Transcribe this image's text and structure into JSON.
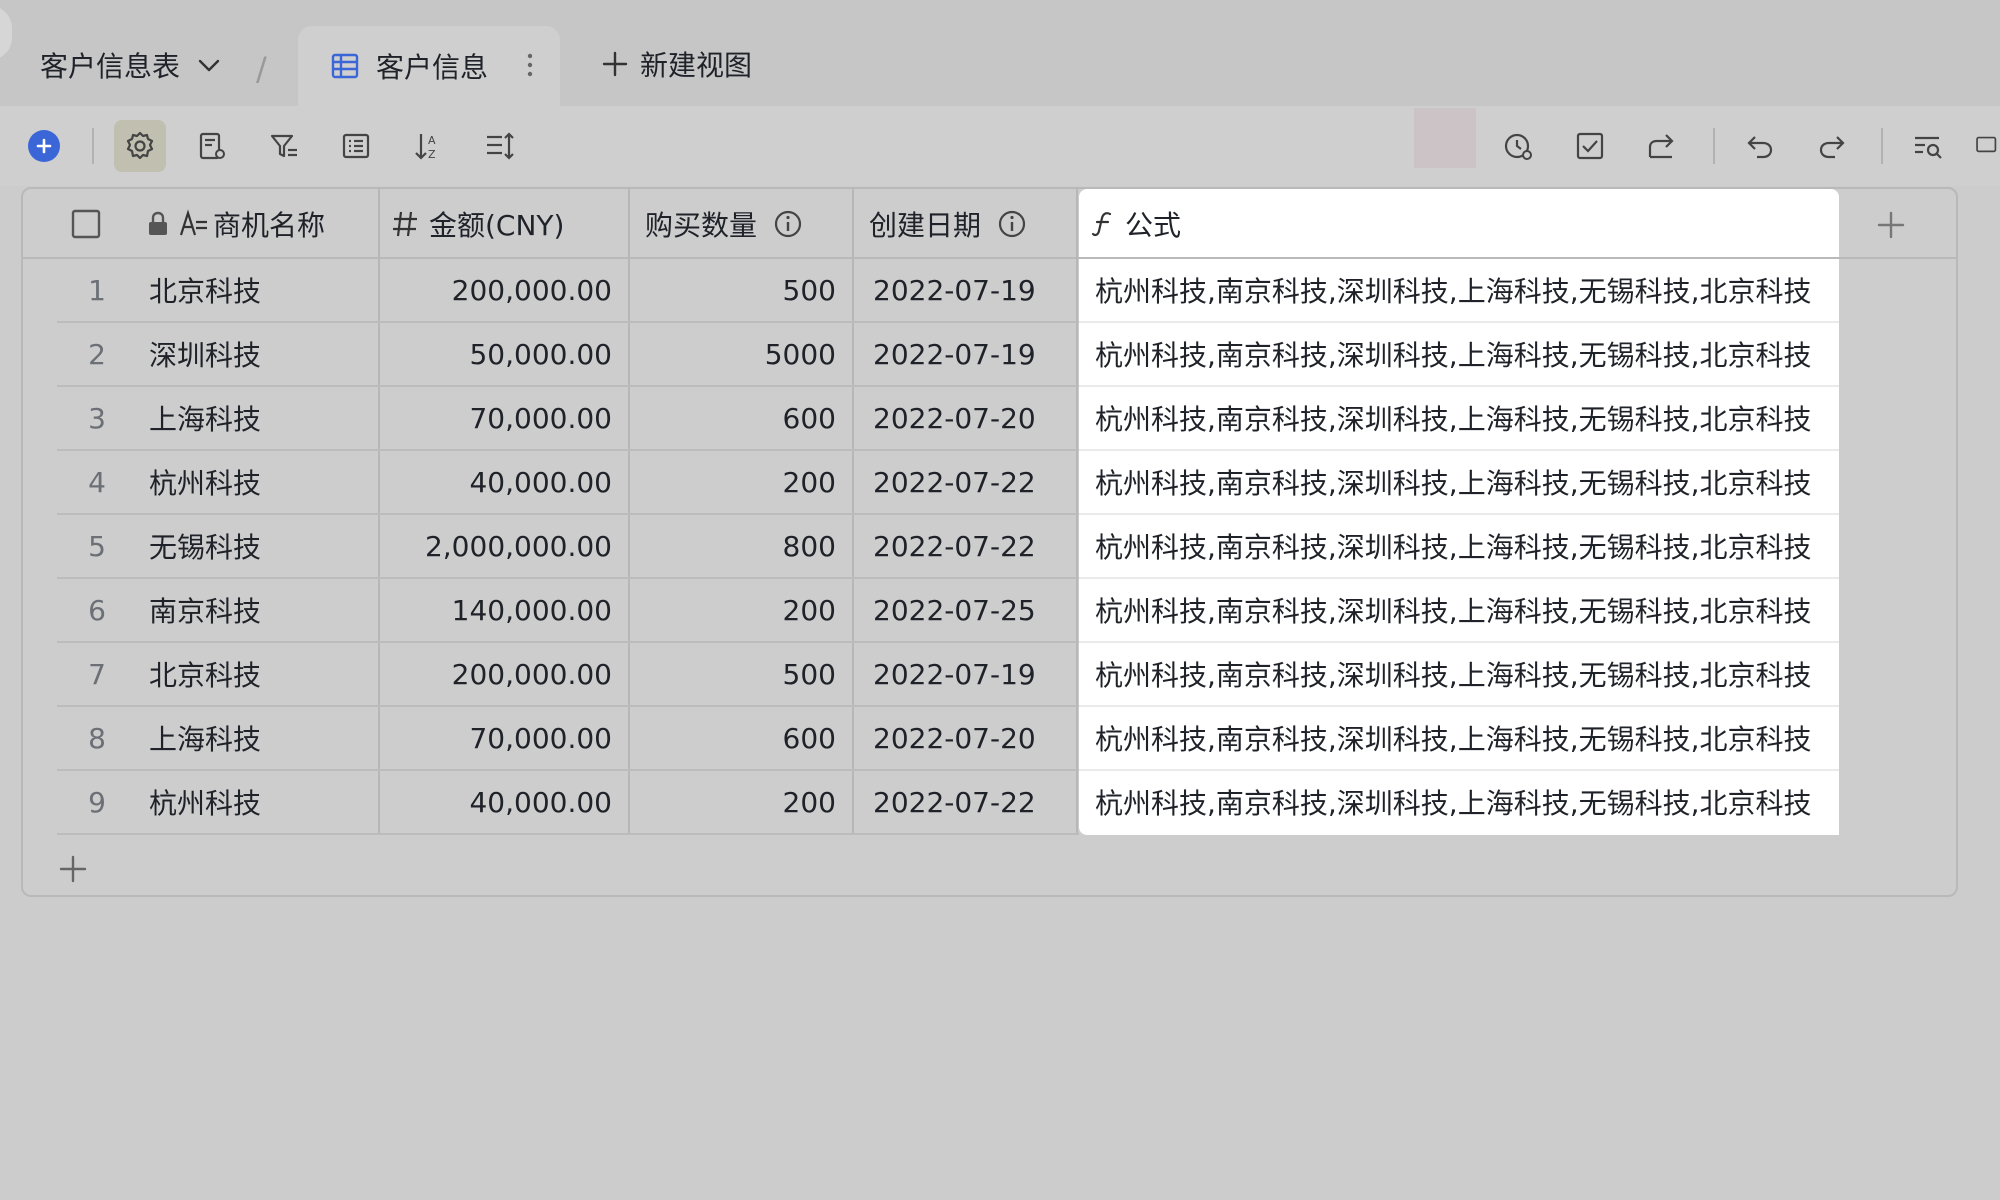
{
  "header": {
    "table_name": "客户信息表",
    "active_tab": "客户信息",
    "new_view_label": "新建视图"
  },
  "toolbar": {
    "left_icons": [
      "add-icon",
      "settings-icon",
      "form-icon",
      "filter-icon",
      "list-icon",
      "sort-icon",
      "row-height-icon"
    ],
    "right_icons": [
      "history-icon",
      "checkbox-icon",
      "share-icon",
      "undo-icon",
      "redo-icon",
      "search-icon",
      "comment-icon"
    ],
    "accent_color": "#3a66d8"
  },
  "columns": {
    "name": "商机名称",
    "amount": "金额(CNY)",
    "quantity": "购买数量",
    "date": "创建日期",
    "formula": "公式"
  },
  "rows": [
    {
      "index": "1",
      "name": "北京科技",
      "amount": "200,000.00",
      "quantity": "500",
      "date": "2022-07-19",
      "formula": "杭州科技,南京科技,深圳科技,上海科技,无锡科技,北京科技"
    },
    {
      "index": "2",
      "name": "深圳科技",
      "amount": "50,000.00",
      "quantity": "5000",
      "date": "2022-07-19",
      "formula": "杭州科技,南京科技,深圳科技,上海科技,无锡科技,北京科技"
    },
    {
      "index": "3",
      "name": "上海科技",
      "amount": "70,000.00",
      "quantity": "600",
      "date": "2022-07-20",
      "formula": "杭州科技,南京科技,深圳科技,上海科技,无锡科技,北京科技"
    },
    {
      "index": "4",
      "name": "杭州科技",
      "amount": "40,000.00",
      "quantity": "200",
      "date": "2022-07-22",
      "formula": "杭州科技,南京科技,深圳科技,上海科技,无锡科技,北京科技"
    },
    {
      "index": "5",
      "name": "无锡科技",
      "amount": "2,000,000.00",
      "quantity": "800",
      "date": "2022-07-22",
      "formula": "杭州科技,南京科技,深圳科技,上海科技,无锡科技,北京科技"
    },
    {
      "index": "6",
      "name": "南京科技",
      "amount": "140,000.00",
      "quantity": "200",
      "date": "2022-07-25",
      "formula": "杭州科技,南京科技,深圳科技,上海科技,无锡科技,北京科技"
    },
    {
      "index": "7",
      "name": "北京科技",
      "amount": "200,000.00",
      "quantity": "500",
      "date": "2022-07-19",
      "formula": "杭州科技,南京科技,深圳科技,上海科技,无锡科技,北京科技"
    },
    {
      "index": "8",
      "name": "上海科技",
      "amount": "70,000.00",
      "quantity": "600",
      "date": "2022-07-20",
      "formula": "杭州科技,南京科技,深圳科技,上海科技,无锡科技,北京科技"
    },
    {
      "index": "9",
      "name": "杭州科技",
      "amount": "40,000.00",
      "quantity": "200",
      "date": "2022-07-22",
      "formula": "杭州科技,南京科技,深圳科技,上海科技,无锡科技,北京科技"
    }
  ]
}
